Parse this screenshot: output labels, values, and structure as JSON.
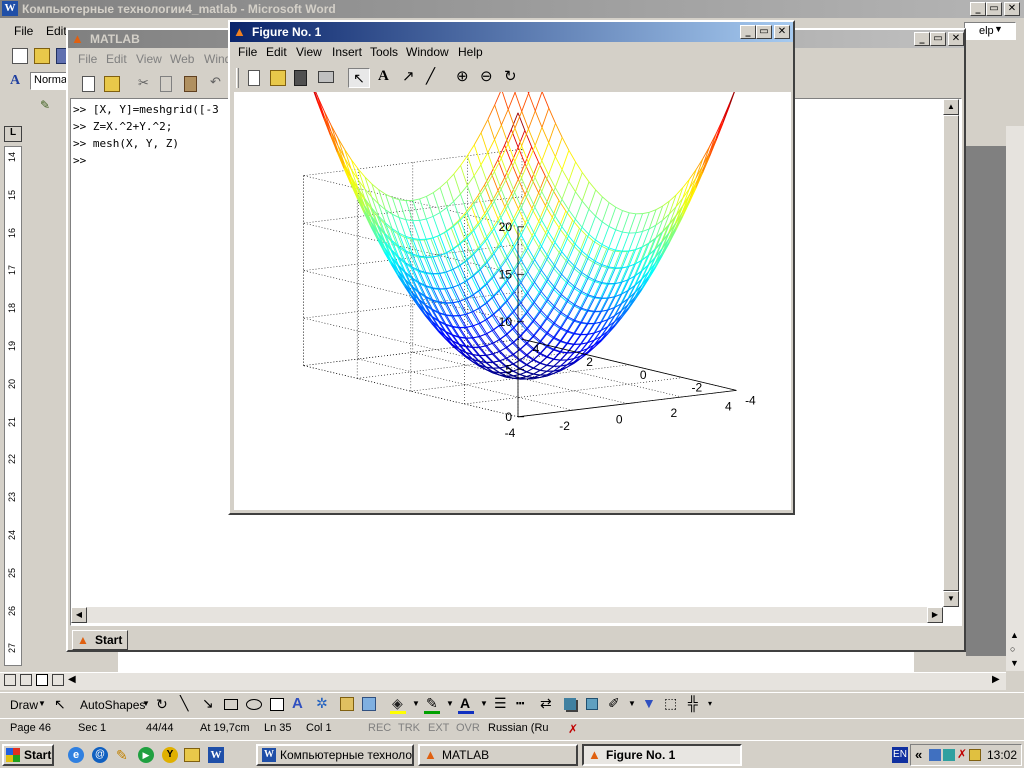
{
  "word": {
    "title": "Компьютерные технологии4_matlab - Microsoft Word",
    "menu": [
      "File",
      "Edit"
    ],
    "style_value": "Normal",
    "help_partial": "elp",
    "status": {
      "page": "Page 46",
      "sec": "Sec 1",
      "pages": "44/44",
      "at": "At 19,7cm",
      "ln": "Ln 35",
      "col": "Col 1",
      "rec": "REC",
      "trk": "TRK",
      "ext": "EXT",
      "ovr": "OVR",
      "lang": "Russian (Ru"
    },
    "ruler_numbers": [
      "14",
      "15",
      "16",
      "17",
      "18",
      "19",
      "20",
      "21",
      "22",
      "23",
      "24",
      "25",
      "26",
      "27"
    ],
    "drawing": {
      "draw": "Draw",
      "autoshapes": "AutoShapes"
    }
  },
  "matlab": {
    "title": "MATLAB",
    "menu": [
      "File",
      "Edit",
      "View",
      "Web",
      "Wind"
    ],
    "lines": [
      ">> [X, Y]=meshgrid([-3",
      ">> Z=X.^2+Y.^2;",
      ">> mesh(X, Y, Z)",
      ">>"
    ],
    "start": "Start"
  },
  "figure": {
    "title": "Figure No. 1",
    "menu": [
      "File",
      "Edit",
      "View",
      "Insert",
      "Tools",
      "Window",
      "Help"
    ]
  },
  "chart_data": {
    "type": "mesh",
    "function": "Z = X.^2 + Y.^2",
    "x_range": [
      -4,
      4
    ],
    "y_range": [
      -4,
      4
    ],
    "z_range": [
      0,
      20
    ],
    "z_ticks": [
      "0",
      "5",
      "10",
      "15",
      "20"
    ],
    "x_ticks": [
      "-4",
      "-2",
      "0",
      "2",
      "4"
    ],
    "y_ticks": [
      "-4",
      "-2",
      "0",
      "2",
      "4"
    ],
    "colormap": "jet",
    "grid": true
  },
  "taskbar": {
    "start": "Start",
    "tasks": [
      "Компьютерные техноло...",
      "MATLAB",
      "Figure No. 1"
    ],
    "lang": "EN",
    "arrows": "«",
    "clock": "13:02"
  }
}
